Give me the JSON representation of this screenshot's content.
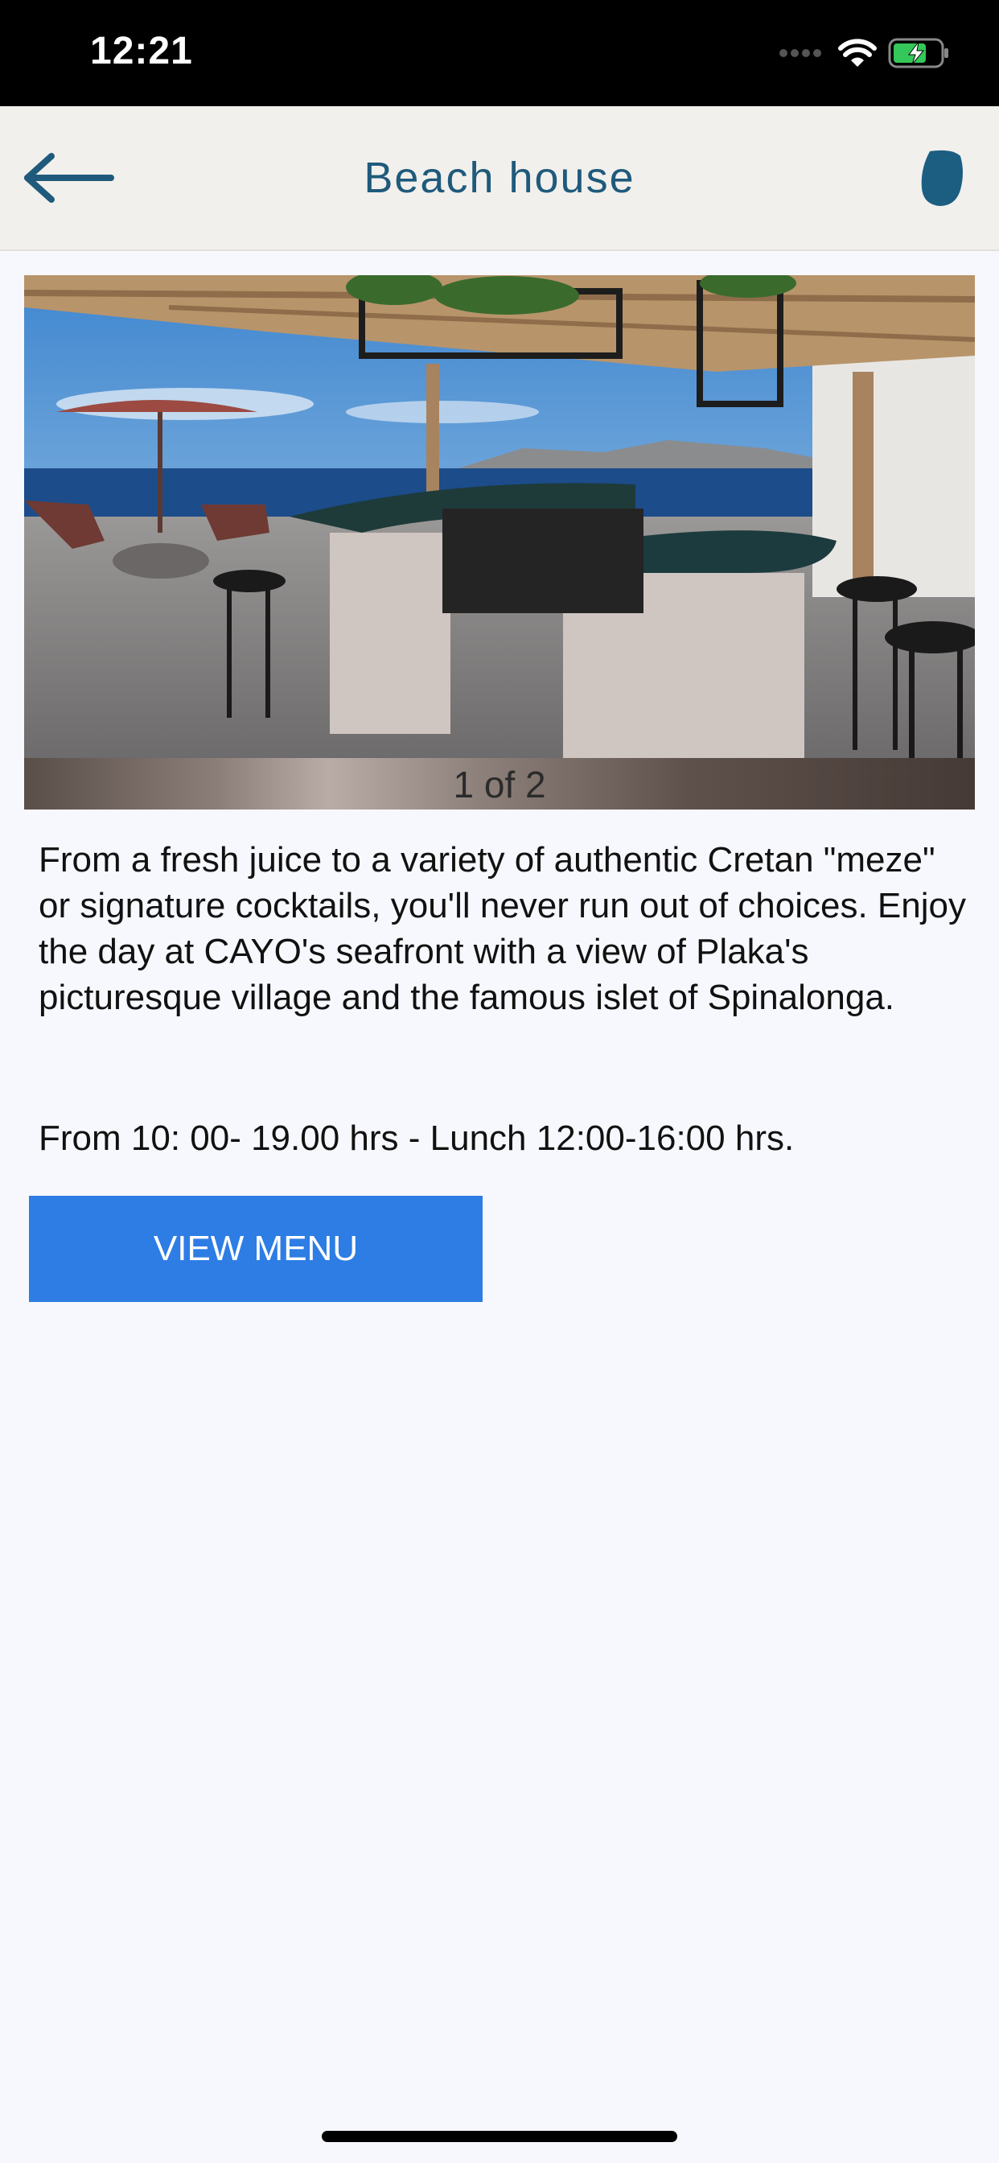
{
  "status_bar": {
    "time": "12:21"
  },
  "nav": {
    "title": "Beach house",
    "back_icon": "arrow-left-icon",
    "logo_icon": "brand-logo-icon",
    "title_color": "#1f5a7c"
  },
  "gallery": {
    "counter": "1 of 2",
    "current": 1,
    "total": 2
  },
  "content": {
    "description": "From a fresh juice to a variety of authentic Cretan \"meze\" or signature cocktails, you'll never run out of choices. Enjoy the day at CAYO's seafront with a view of Plaka's picturesque village and the famous islet of Spinalonga.",
    "hours": "From 10: 00- 19.00 hrs - Lunch 12:00-16:00 hrs."
  },
  "actions": {
    "view_menu_label": "VIEW MENU",
    "button_color": "#2d7de4"
  }
}
